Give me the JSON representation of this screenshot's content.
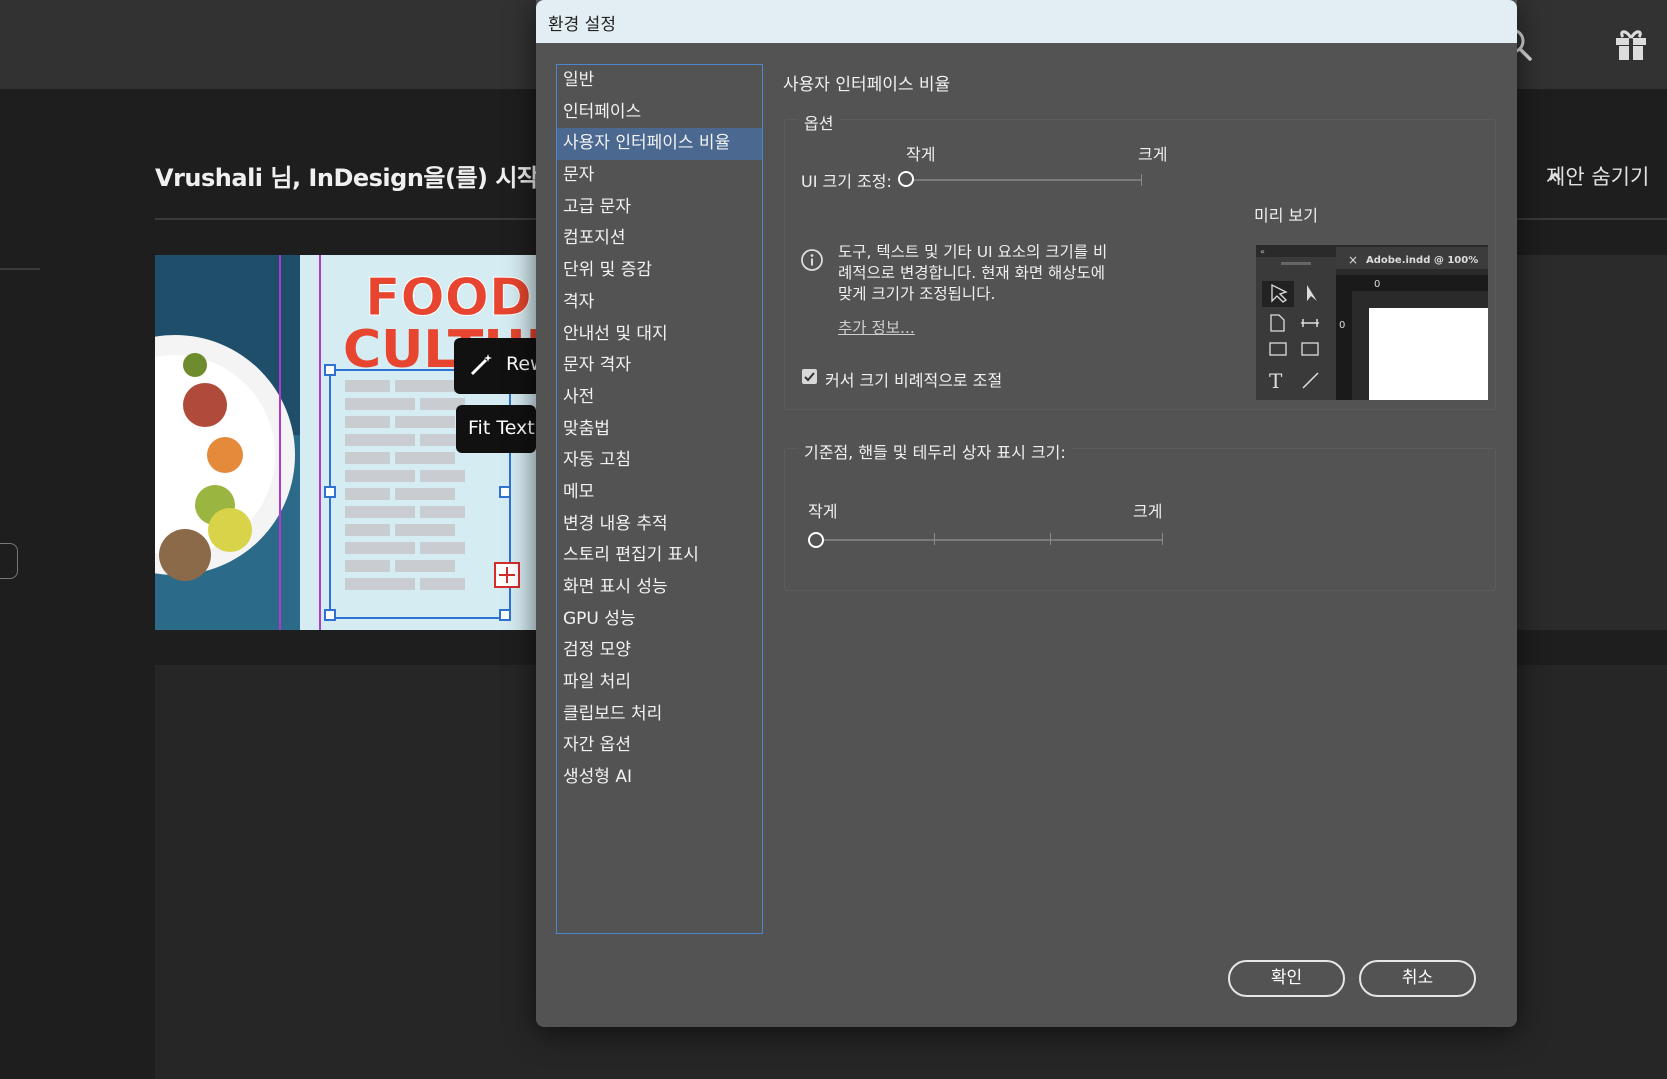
{
  "background": {
    "welcome_title": "Vrushali 님, InDesign을(를) 시작합니다",
    "hide_suggestions": "제안 숨기기",
    "thumb": {
      "headline_line1": "FOOD",
      "headline_line2": "CULTURE",
      "chip_rewrite": "Rewrite",
      "chip_fit_text": "Fit Text"
    },
    "icons": [
      "search-icon",
      "gift-icon"
    ]
  },
  "dialog": {
    "title": "환경 설정",
    "nav_items": [
      "일반",
      "인터페이스",
      "사용자 인터페이스 비율",
      "문자",
      "고급 문자",
      "컴포지션",
      "단위 및 증감",
      "격자",
      "안내선 및 대지",
      "문자 격자",
      "사전",
      "맞춤법",
      "자동 고침",
      "메모",
      "변경 내용 추적",
      "스토리 편집기 표시",
      "화면 표시 성능",
      "GPU 성능",
      "검정 모양",
      "파일 처리",
      "클립보드 처리",
      "자간 옵션",
      "생성형 AI"
    ],
    "selected_index": 2,
    "panel_title": "사용자 인터페이스 비율",
    "options": {
      "legend": "옵션",
      "small_label": "작게",
      "large_label": "크게",
      "ui_scale_label": "UI 크기 조정:",
      "ui_scale_value": 0,
      "preview_label": "미리 보기",
      "info_text": "도구, 텍스트 및 기타 UI 요소의 크기를 비례적으로 변경합니다. 현재 화면 해상도에 맞게 크기가 조정됩니다.",
      "more_info_link": "추가 정보...",
      "cursor_scale_label": "커서 크기 비례적으로 조절",
      "cursor_scale_checked": true
    },
    "anchor_group": {
      "legend": "기준점, 핸들 및 테두리 상자 표시 크기:",
      "small_label": "작게",
      "large_label": "크게",
      "value": 0
    },
    "preview": {
      "tab_close": "×",
      "tab_label": "Adobe.indd @ 100%",
      "ruler_zero_h": "0",
      "ruler_zero_v": "0",
      "collapse": "«"
    },
    "ok_label": "확인",
    "cancel_label": "취소"
  }
}
